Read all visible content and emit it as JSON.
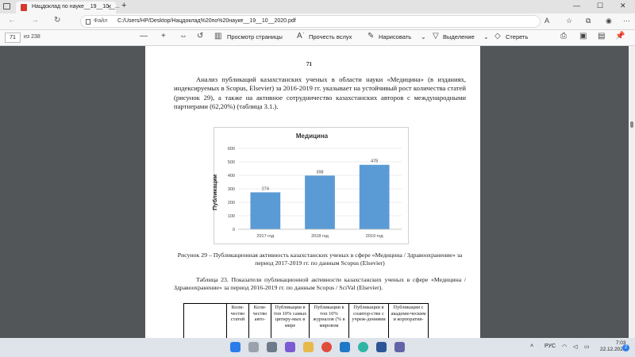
{
  "browser": {
    "tab_title": "Нацдоклад по науке__19__10__...",
    "tab_close": "✕",
    "new_tab": "+",
    "file_label": "Файл",
    "url": "C:/Users/HP/Desktop/Нацдоклад%20по%20науке__19__10__2020.pdf",
    "min": "—",
    "max": "☐",
    "close": "✕",
    "back": "←",
    "forward": "→",
    "refresh": "↻"
  },
  "pdf_toolbar": {
    "page_current": "71",
    "page_count": "из 238",
    "zoom_out": "—",
    "zoom_in": "+",
    "fit_page": "Просмотр страницы",
    "read_aloud": "Прочесть вслух",
    "draw": "Нарисовать",
    "highlight": "Выделение",
    "erase": "Стереть"
  },
  "document": {
    "page_number": "71",
    "paragraph": "Анализ публикаций казахстанских ученых в области науки «Медицина» (в изданиях, индексируемых в Scopus, Elsevier) за 2016-2019 гг. указывает на устойчивый рост количества статей (рисунок 29), а также на активное сотрудничество казахстанских авторов с международными партнерами (62,20%) (таблица 3.1.).",
    "figure_caption": "Рисунок 29 – Публикационная активность казахстанских ученых в сфере «Медицина / Здравоохранение» за период 2017-2019 гг. по данным Scopus (Elsevier)",
    "table_title": "Таблица 23. Показатели публикационной активности казахстанских ученых в сфере «Медицина / Здравоохранение» за период 2016-2019 гг. по данным Scopus / SciVal (Elsevier).",
    "table_headers": [
      "",
      "Коли-чество статей",
      "Коли-чество авто-",
      "Публикации в топ 10% самых цитиру-мых в мире",
      "Публикации в топ 10% журналов (% в мировом",
      "Публикации в соавтор-стве с учреж-дениями",
      "Публикации с академи-ческим и корпоратив-"
    ]
  },
  "chart_data": {
    "type": "bar",
    "title": "Медицина",
    "ylabel": "Публикации",
    "xlabel": "",
    "categories": [
      "2017 год",
      "2018 год",
      "2019 год"
    ],
    "values": [
      274,
      398,
      478
    ],
    "ylim": [
      0,
      600
    ],
    "yticks": [
      0,
      100,
      200,
      300,
      400,
      500,
      600
    ],
    "bar_color": "#5b9bd5",
    "grid": true,
    "legend": "none"
  },
  "taskbar": {
    "lang": "РУС",
    "time": "7:03",
    "date": "22.12.2021",
    "notif": "2"
  }
}
